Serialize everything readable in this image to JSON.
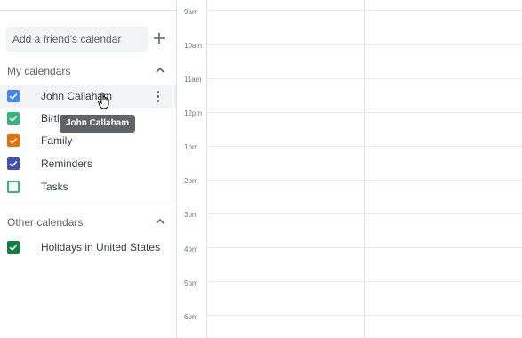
{
  "search": {
    "placeholder": "Add a friend's calendar",
    "add_icon": "plus-icon"
  },
  "my_calendars": {
    "title": "My calendars",
    "items": [
      {
        "label": "John Callaham",
        "color": "#4285f4",
        "checked": true
      },
      {
        "label": "Birth",
        "color": "#33b679",
        "checked": true
      },
      {
        "label": "Family",
        "color": "#ef6c00",
        "checked": true
      },
      {
        "label": "Reminders",
        "color": "#3f51b5",
        "checked": true
      },
      {
        "label": "Tasks",
        "color": "#33b679",
        "checked": false
      }
    ]
  },
  "other_calendars": {
    "title": "Other calendars",
    "items": [
      {
        "label": "Holidays in United States",
        "color": "#0b8043",
        "checked": true
      }
    ]
  },
  "tooltip": {
    "text": "John Callaham"
  },
  "times": [
    "9am",
    "10am",
    "11am",
    "12pm",
    "1pm",
    "2pm",
    "3pm",
    "4pm",
    "5pm",
    "6pm"
  ]
}
